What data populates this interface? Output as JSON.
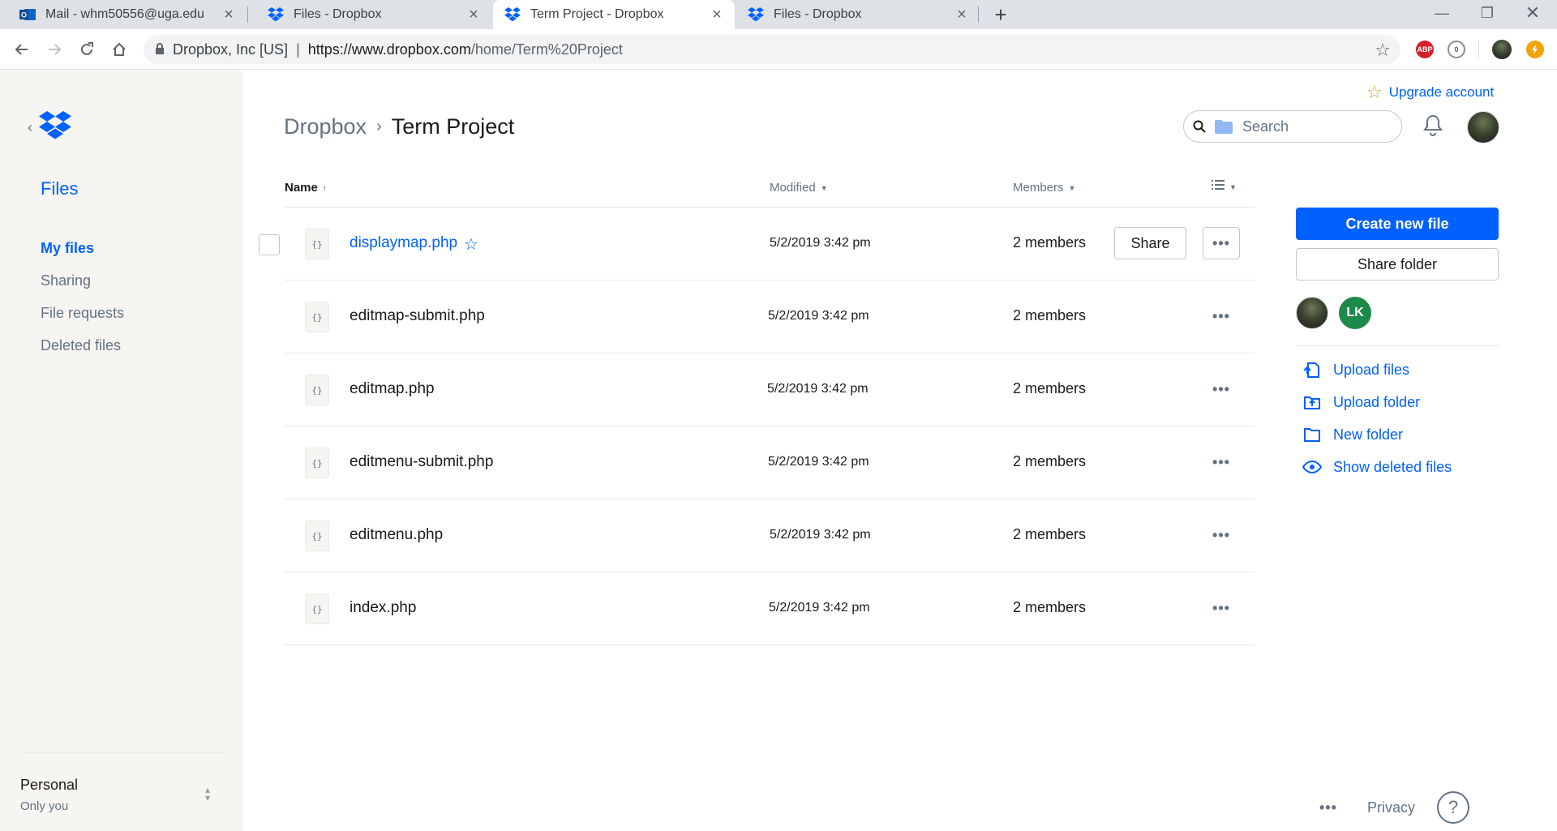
{
  "browser": {
    "tabs": [
      {
        "title": "Mail - whm50556@uga.edu",
        "icon": "outlook-icon",
        "active": false
      },
      {
        "title": "Files - Dropbox",
        "icon": "dropbox-icon",
        "active": false
      },
      {
        "title": "Term Project - Dropbox",
        "icon": "dropbox-icon",
        "active": true
      },
      {
        "title": "Files - Dropbox",
        "icon": "dropbox-icon",
        "active": false
      }
    ],
    "site_identity": "Dropbox, Inc [US]",
    "url_host": "https://www.dropbox.com",
    "url_path": "/home/Term%20Project",
    "extensions": [
      {
        "label": "ABP",
        "color": "#d5202c"
      },
      {
        "label": "0",
        "color": "#8e8e8e"
      },
      {
        "label": "",
        "color": "#f0a30a"
      }
    ]
  },
  "sidebar": {
    "files_label": "Files",
    "nav": [
      {
        "label": "My files",
        "active": true
      },
      {
        "label": "Sharing",
        "active": false
      },
      {
        "label": "File requests",
        "active": false
      },
      {
        "label": "Deleted files",
        "active": false
      }
    ],
    "account": {
      "name": "Personal",
      "sub": "Only you"
    }
  },
  "header": {
    "upgrade_label": "Upgrade account",
    "breadcrumb_root": "Dropbox",
    "breadcrumb_current": "Term Project",
    "search_placeholder": "Search"
  },
  "table": {
    "columns": {
      "name": "Name",
      "modified": "Modified",
      "members": "Members"
    },
    "rows": [
      {
        "name": "displaymap.php",
        "modified": "5/2/2019 3:42 pm",
        "members": "2 members",
        "hovered": true,
        "starred": true
      },
      {
        "name": "editmap-submit.php",
        "modified": "5/2/2019 3:42 pm",
        "members": "2 members"
      },
      {
        "name": "editmap.php",
        "modified": "5/2/2019 3:42 pm",
        "members": "2 members"
      },
      {
        "name": "editmenu-submit.php",
        "modified": "5/2/2019 3:42 pm",
        "members": "2 members"
      },
      {
        "name": "editmenu.php",
        "modified": "5/2/2019 3:42 pm",
        "members": "2 members"
      },
      {
        "name": "index.php",
        "modified": "5/2/2019 3:42 pm",
        "members": "2 members"
      }
    ],
    "share_label": "Share",
    "file_icon_glyph": "{}"
  },
  "right_panel": {
    "create_label": "Create new file",
    "share_folder_label": "Share folder",
    "member_initials": "LK",
    "member_color": "#1e8a4a",
    "actions": [
      {
        "label": "Upload files",
        "icon": "upload-file-icon"
      },
      {
        "label": "Upload folder",
        "icon": "upload-folder-icon"
      },
      {
        "label": "New folder",
        "icon": "new-folder-icon"
      },
      {
        "label": "Show deleted files",
        "icon": "eye-icon"
      }
    ]
  },
  "footer": {
    "more_label": "•••",
    "privacy_label": "Privacy",
    "help_label": "?"
  },
  "colors": {
    "accent": "#0061fe",
    "muted": "#637282",
    "sidebar_bg": "#f7f5f2"
  }
}
